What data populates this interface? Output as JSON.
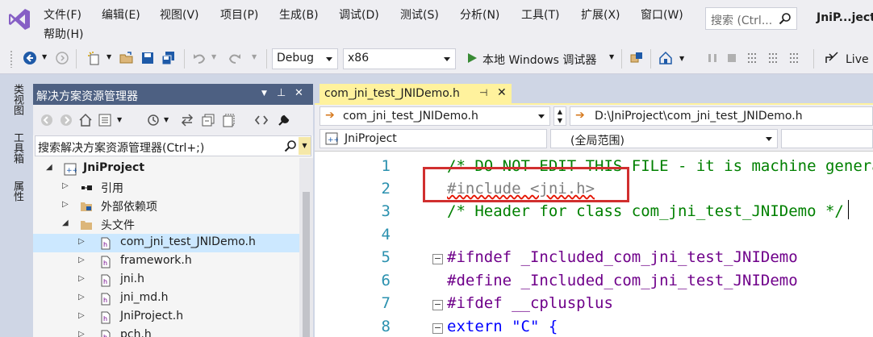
{
  "menu": {
    "items": [
      "文件(F)",
      "编辑(E)",
      "视图(V)",
      "项目(P)",
      "生成(B)",
      "调试(D)",
      "测试(S)",
      "分析(N)",
      "工具(T)",
      "扩展(X)",
      "窗口(W)",
      "帮助(H)"
    ],
    "search_placeholder": "搜索 (Ctrl...",
    "window_title": "JniP...ject"
  },
  "toolbar": {
    "configuration": "Debug",
    "platform": "x86",
    "run_label": "本地 Windows 调试器",
    "live_label": "Live"
  },
  "side_tabs": [
    "类视图",
    "工具箱",
    "属性"
  ],
  "solution_explorer": {
    "title": "解决方案资源管理器",
    "search_placeholder": "搜索解决方案资源管理器(Ctrl+;)",
    "tree": [
      {
        "label": "JniProject",
        "bold": true
      },
      {
        "label": "引用"
      },
      {
        "label": "外部依赖项"
      },
      {
        "label": "头文件"
      },
      {
        "label": "com_jni_test_JNIDemo.h"
      },
      {
        "label": "framework.h"
      },
      {
        "label": "jni.h"
      },
      {
        "label": "jni_md.h"
      },
      {
        "label": "JniProject.h"
      },
      {
        "label": "pch.h"
      }
    ]
  },
  "editor": {
    "tab_label": "com_jni_test_JNIDemo.h",
    "nav_file": "com_jni_test_JNIDemo.h",
    "nav_path": "D:\\JniProject\\com_jni_test_JNIDemo.h",
    "nav_project": "JniProject",
    "nav_scope": "(全局范围)",
    "lines": [
      {
        "no": "1",
        "text": "/* DO NOT EDIT THIS FILE - it is machine genera"
      },
      {
        "no": "2",
        "text": "#include <jni.h>"
      },
      {
        "no": "3",
        "text": "/* Header for class com_jni_test_JNIDemo */"
      },
      {
        "no": "4",
        "text": ""
      },
      {
        "no": "5",
        "text": "#ifndef _Included_com_jni_test_JNIDemo"
      },
      {
        "no": "6",
        "text": "#define _Included_com_jni_test_JNIDemo"
      },
      {
        "no": "7",
        "text": "#ifdef __cplusplus"
      },
      {
        "no": "8",
        "text": "extern \"C\" {"
      }
    ]
  },
  "colors": {
    "title_bar": "#4d6082",
    "active_tab": "#fff29d",
    "highlight_box": "#d12f2f",
    "comment": "#008000",
    "macro": "#6f008a",
    "string": "#a31515",
    "keyword": "#0000ff",
    "line_number": "#2b91af"
  }
}
